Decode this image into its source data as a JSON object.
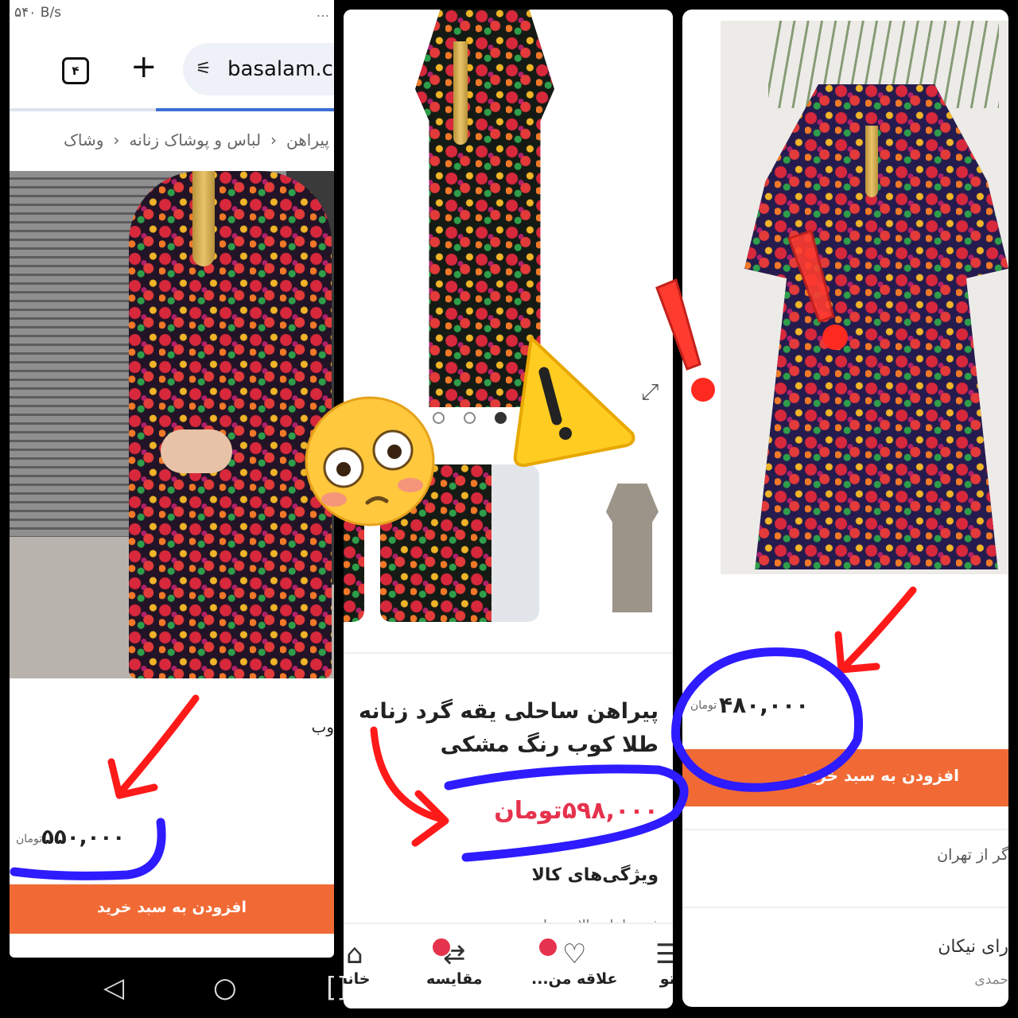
{
  "status_bar": {
    "left_text": "۵۴۰ B/s",
    "right_text": "..."
  },
  "browser": {
    "tab_count": "۴",
    "new_tab_symbol": "+",
    "url": "basalam.c",
    "site_icon": "tune-icon",
    "load_progress_fraction": 0.55
  },
  "breadcrumb": {
    "items": [
      "وشاک",
      "لباس و پوشاک زنانه",
      "پیراهن"
    ],
    "separator": "‹"
  },
  "listing_left": {
    "title_fragment": "وب",
    "price": "۵۵۰,۰۰۰",
    "currency": "تومان",
    "add_to_cart_label": "افزودن به سبد خرید"
  },
  "listing_center": {
    "title": "پیراهن ساحلی یقه گرد زنانه طلا کوب رنگ مشکی",
    "price": "۵۹۸,۰۰۰تومان",
    "features_heading": "ویژگی‌های کالا",
    "features_peek": "فرم داخلی بالاتنه ساده",
    "expand_icon": "expand-arrows-icon",
    "bottom_nav": [
      {
        "label": "خانه",
        "icon": "home-icon"
      },
      {
        "label": "مقایسه",
        "icon": "shuffle-icon"
      },
      {
        "label": "علاقه من...",
        "icon": "heart-icon"
      },
      {
        "label": "تو",
        "icon": "menu-icon"
      }
    ]
  },
  "listing_right": {
    "price": "۴۸۰,۰۰۰",
    "currency": "تومان",
    "add_to_cart_label": "افزودن به سبد خرید",
    "shipping_from": "گر از تهران",
    "seller_name": "رای نیکان",
    "seller_sub": "حمدی"
  },
  "annotations": {
    "emoji": "flushed-face-emoji",
    "warning": "warning-sign-emoji",
    "exclamations": "red-exclamation-mark",
    "colors": {
      "arrow_red": "#ff1a1a",
      "scribble_blue": "#2e1bff",
      "accent_orange": "#f16a35",
      "price_red": "#e6334d"
    }
  },
  "android_nav": {
    "back": "◁",
    "home": "○",
    "recents": "[]"
  }
}
